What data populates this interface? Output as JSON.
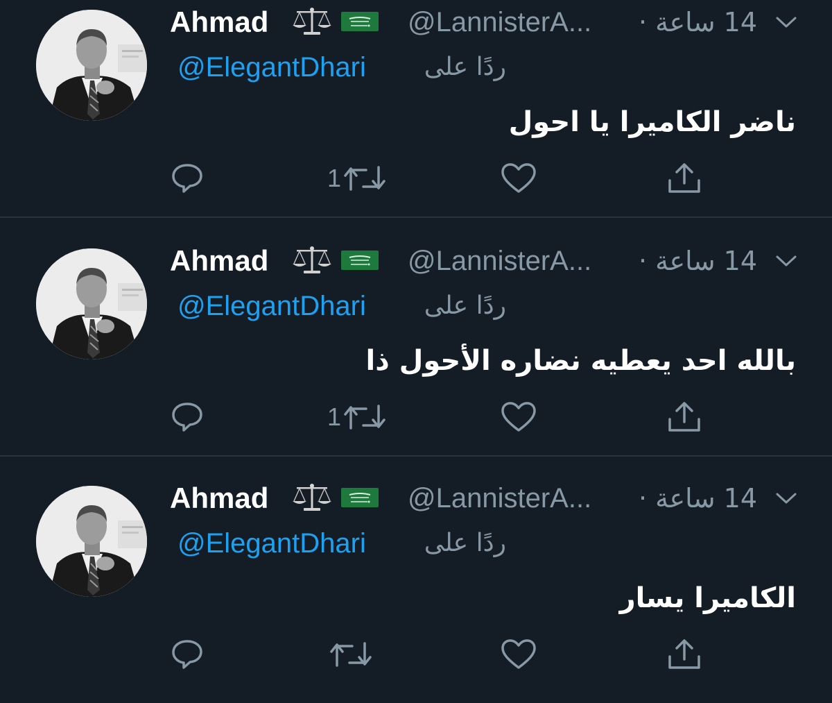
{
  "colors": {
    "background": "#141d26",
    "name": "#ffffff",
    "secondary_text": "#8899a6",
    "mention": "#1da1f2",
    "divider": "#2a3540"
  },
  "tweets": [
    {
      "author_name": "Ahmad",
      "emoji_icons": [
        "scales-icon",
        "saudi-flag-icon"
      ],
      "handle": "@LannisterA...",
      "time": "14 ساعة ·",
      "reply_label": "ردًا على",
      "reply_mention": "@ElegantDhari",
      "text": "ناضر الكاميرا يا احول",
      "retweet_count": "1"
    },
    {
      "author_name": "Ahmad",
      "emoji_icons": [
        "scales-icon",
        "saudi-flag-icon"
      ],
      "handle": "@LannisterA...",
      "time": "14 ساعة ·",
      "reply_label": "ردًا على",
      "reply_mention": "@ElegantDhari",
      "text": "بالله احد يعطيه نضاره الأحول ذا",
      "retweet_count": "1"
    },
    {
      "author_name": "Ahmad",
      "emoji_icons": [
        "scales-icon",
        "saudi-flag-icon"
      ],
      "handle": "@LannisterA...",
      "time": "14 ساعة ·",
      "reply_label": "ردًا على",
      "reply_mention": "@ElegantDhari",
      "text": "الكاميرا يسار",
      "retweet_count": ""
    }
  ]
}
